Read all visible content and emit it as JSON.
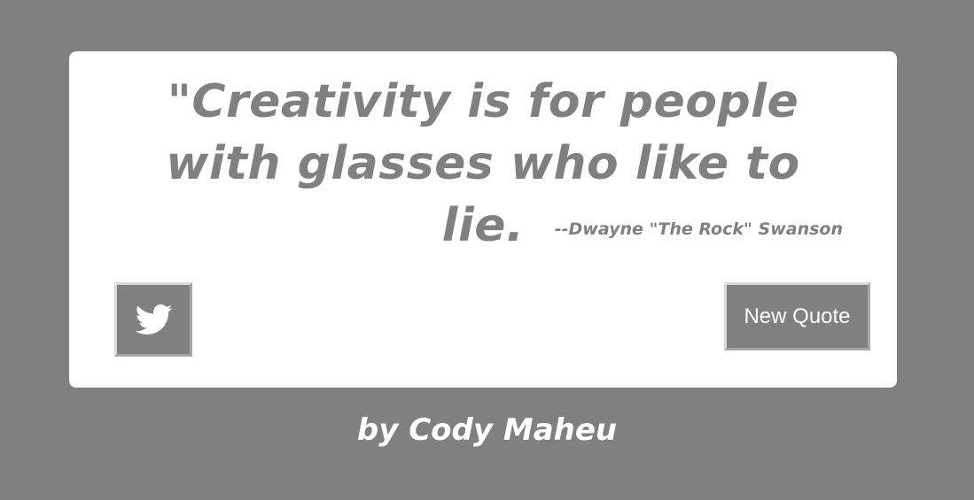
{
  "quote": {
    "text": "\"Creativity is for people with glasses who like to lie.",
    "author": "--Dwayne \"The Rock\" Swanson"
  },
  "buttons": {
    "tweet_icon": "twitter-bird-icon",
    "new_quote_label": "New Quote"
  },
  "footer": {
    "byline": "by Cody Maheu"
  },
  "colors": {
    "background": "#808080",
    "card": "#ffffff",
    "quote_text": "#808080",
    "button_bg": "#808080",
    "button_text": "#ffffff"
  }
}
